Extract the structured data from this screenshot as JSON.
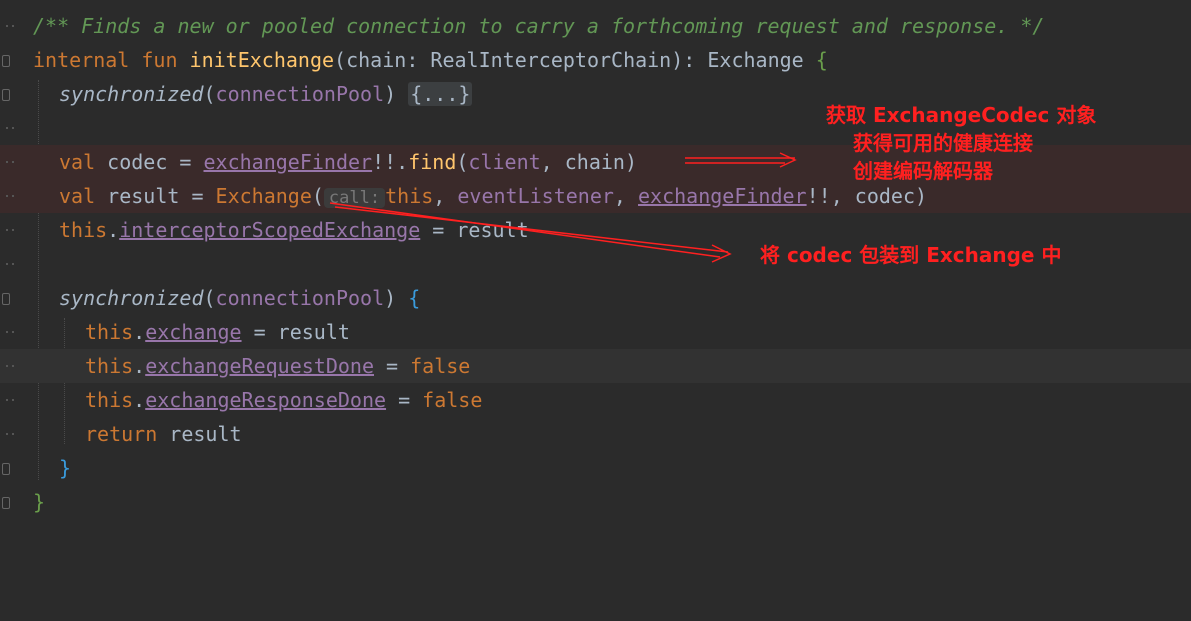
{
  "code": {
    "comment": "/** Finds a new or pooled connection to carry a forthcoming request and response. */",
    "kw_internal": "internal",
    "kw_fun": "fun",
    "fn_name": "initExchange",
    "sig_open": "(",
    "param": "chain",
    "sig_colon": ": ",
    "param_type": "RealInterceptorChain",
    "sig_close": "): ",
    "return_type": "Exchange",
    "open_brace": " {",
    "sync1": "synchronized",
    "pool1": "connectionPool",
    "collapsed": "{...}",
    "kw_val1": "val",
    "codec_decl": " codec = ",
    "exchange_finder1": "exchangeFinder",
    "bang1": "!!.",
    "find_fn": "find",
    "find_args_open": "(",
    "find_arg_client": "client",
    "find_args_sep": ", ",
    "find_arg_chain": "chain",
    "find_args_close": ")",
    "kw_val2": "val",
    "result_decl": " result = ",
    "exchange_ctor": "Exchange",
    "ctor_open": "(",
    "hint_call": "call:",
    "kw_this1": "this",
    "ctor_sep1": ", ",
    "event_listener": "eventListener",
    "ctor_sep2": ", ",
    "exchange_finder2": "exchangeFinder",
    "bang2": "!!",
    "ctor_sep3": ", ",
    "codec_arg": "codec",
    "ctor_close": ")",
    "kw_this2": "this",
    "dot1": ".",
    "interceptor_scoped": "interceptorScopedExchange",
    "assign1": " = ",
    "result1": "result",
    "sync2": "synchronized",
    "pool2": "connectionPool",
    "brace_hl_open": "{",
    "kw_this3": "this",
    "dot2": ".",
    "prop_exchange": "exchange",
    "assign2": " = ",
    "result2": "result",
    "kw_this4": "this",
    "dot3": ".",
    "prop_req_done": "exchangeRequestDone",
    "assign3": " = ",
    "false1": "false",
    "kw_this5": "this",
    "dot4": ".",
    "prop_resp_done": "exchangeResponseDone",
    "assign4": " = ",
    "false2": "false",
    "kw_return": "return",
    "result3": " result",
    "brace_hl_close": "}",
    "final_brace": "}"
  },
  "annotations": {
    "a1": "获取 ExchangeCodec 对象",
    "a2": "获得可用的健康连接",
    "a3": "创建编码解码器",
    "a4": "将 codec 包装到 Exchange 中"
  },
  "colors": {
    "background": "#2b2b2b",
    "annotation": "#ff2020",
    "keyword": "#cc7832",
    "function": "#ffc66d",
    "comment": "#629755",
    "property": "#9876aa"
  }
}
